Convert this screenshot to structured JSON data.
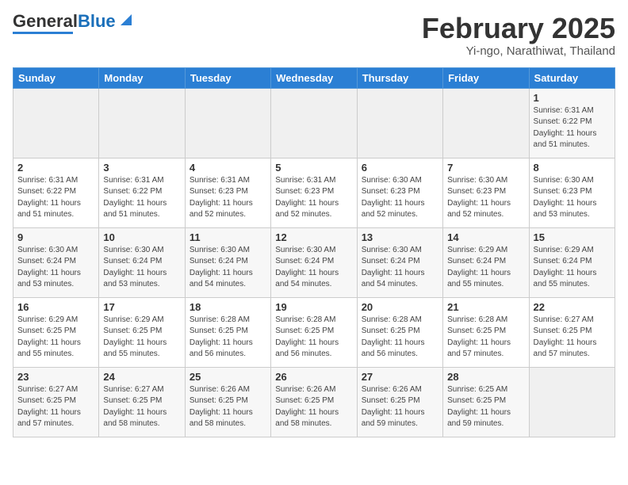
{
  "logo": {
    "part1": "General",
    "part2": "Blue"
  },
  "title": "February 2025",
  "location": "Yi-ngo, Narathiwat, Thailand",
  "weekdays": [
    "Sunday",
    "Monday",
    "Tuesday",
    "Wednesday",
    "Thursday",
    "Friday",
    "Saturday"
  ],
  "weeks": [
    [
      {
        "day": "",
        "detail": ""
      },
      {
        "day": "",
        "detail": ""
      },
      {
        "day": "",
        "detail": ""
      },
      {
        "day": "",
        "detail": ""
      },
      {
        "day": "",
        "detail": ""
      },
      {
        "day": "",
        "detail": ""
      },
      {
        "day": "1",
        "detail": "Sunrise: 6:31 AM\nSunset: 6:22 PM\nDaylight: 11 hours\nand 51 minutes."
      }
    ],
    [
      {
        "day": "2",
        "detail": "Sunrise: 6:31 AM\nSunset: 6:22 PM\nDaylight: 11 hours\nand 51 minutes."
      },
      {
        "day": "3",
        "detail": "Sunrise: 6:31 AM\nSunset: 6:22 PM\nDaylight: 11 hours\nand 51 minutes."
      },
      {
        "day": "4",
        "detail": "Sunrise: 6:31 AM\nSunset: 6:23 PM\nDaylight: 11 hours\nand 52 minutes."
      },
      {
        "day": "5",
        "detail": "Sunrise: 6:31 AM\nSunset: 6:23 PM\nDaylight: 11 hours\nand 52 minutes."
      },
      {
        "day": "6",
        "detail": "Sunrise: 6:30 AM\nSunset: 6:23 PM\nDaylight: 11 hours\nand 52 minutes."
      },
      {
        "day": "7",
        "detail": "Sunrise: 6:30 AM\nSunset: 6:23 PM\nDaylight: 11 hours\nand 52 minutes."
      },
      {
        "day": "8",
        "detail": "Sunrise: 6:30 AM\nSunset: 6:23 PM\nDaylight: 11 hours\nand 53 minutes."
      }
    ],
    [
      {
        "day": "9",
        "detail": "Sunrise: 6:30 AM\nSunset: 6:24 PM\nDaylight: 11 hours\nand 53 minutes."
      },
      {
        "day": "10",
        "detail": "Sunrise: 6:30 AM\nSunset: 6:24 PM\nDaylight: 11 hours\nand 53 minutes."
      },
      {
        "day": "11",
        "detail": "Sunrise: 6:30 AM\nSunset: 6:24 PM\nDaylight: 11 hours\nand 54 minutes."
      },
      {
        "day": "12",
        "detail": "Sunrise: 6:30 AM\nSunset: 6:24 PM\nDaylight: 11 hours\nand 54 minutes."
      },
      {
        "day": "13",
        "detail": "Sunrise: 6:30 AM\nSunset: 6:24 PM\nDaylight: 11 hours\nand 54 minutes."
      },
      {
        "day": "14",
        "detail": "Sunrise: 6:29 AM\nSunset: 6:24 PM\nDaylight: 11 hours\nand 55 minutes."
      },
      {
        "day": "15",
        "detail": "Sunrise: 6:29 AM\nSunset: 6:24 PM\nDaylight: 11 hours\nand 55 minutes."
      }
    ],
    [
      {
        "day": "16",
        "detail": "Sunrise: 6:29 AM\nSunset: 6:25 PM\nDaylight: 11 hours\nand 55 minutes."
      },
      {
        "day": "17",
        "detail": "Sunrise: 6:29 AM\nSunset: 6:25 PM\nDaylight: 11 hours\nand 55 minutes."
      },
      {
        "day": "18",
        "detail": "Sunrise: 6:28 AM\nSunset: 6:25 PM\nDaylight: 11 hours\nand 56 minutes."
      },
      {
        "day": "19",
        "detail": "Sunrise: 6:28 AM\nSunset: 6:25 PM\nDaylight: 11 hours\nand 56 minutes."
      },
      {
        "day": "20",
        "detail": "Sunrise: 6:28 AM\nSunset: 6:25 PM\nDaylight: 11 hours\nand 56 minutes."
      },
      {
        "day": "21",
        "detail": "Sunrise: 6:28 AM\nSunset: 6:25 PM\nDaylight: 11 hours\nand 57 minutes."
      },
      {
        "day": "22",
        "detail": "Sunrise: 6:27 AM\nSunset: 6:25 PM\nDaylight: 11 hours\nand 57 minutes."
      }
    ],
    [
      {
        "day": "23",
        "detail": "Sunrise: 6:27 AM\nSunset: 6:25 PM\nDaylight: 11 hours\nand 57 minutes."
      },
      {
        "day": "24",
        "detail": "Sunrise: 6:27 AM\nSunset: 6:25 PM\nDaylight: 11 hours\nand 58 minutes."
      },
      {
        "day": "25",
        "detail": "Sunrise: 6:26 AM\nSunset: 6:25 PM\nDaylight: 11 hours\nand 58 minutes."
      },
      {
        "day": "26",
        "detail": "Sunrise: 6:26 AM\nSunset: 6:25 PM\nDaylight: 11 hours\nand 58 minutes."
      },
      {
        "day": "27",
        "detail": "Sunrise: 6:26 AM\nSunset: 6:25 PM\nDaylight: 11 hours\nand 59 minutes."
      },
      {
        "day": "28",
        "detail": "Sunrise: 6:25 AM\nSunset: 6:25 PM\nDaylight: 11 hours\nand 59 minutes."
      },
      {
        "day": "",
        "detail": ""
      }
    ]
  ]
}
